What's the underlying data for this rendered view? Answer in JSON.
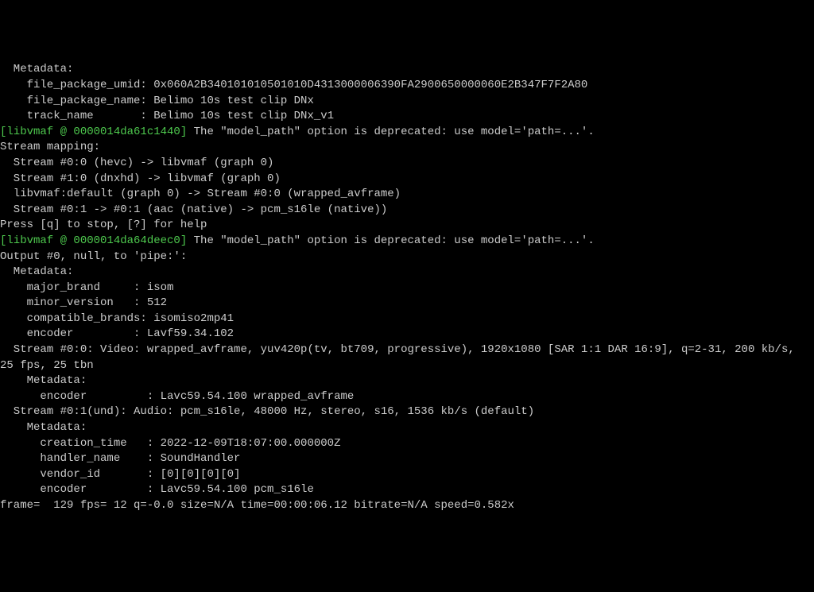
{
  "lines": {
    "l1": "  Metadata:",
    "l2": "    file_package_umid: 0x060A2B340101010501010D4313000006390FA2900650000060E2B347F7F2A80",
    "l3": "    file_package_name: Belimo 10s test clip DNx",
    "l4": "    track_name       : Belimo 10s test clip DNx_v1",
    "l5_tag": "[libvmaf @ 0000014da61c1440]",
    "l5_msg": " The \"model_path\" option is deprecated: use model='path=...'.",
    "l6": "Stream mapping:",
    "l7": "  Stream #0:0 (hevc) -> libvmaf (graph 0)",
    "l8": "  Stream #1:0 (dnxhd) -> libvmaf (graph 0)",
    "l9": "  libvmaf:default (graph 0) -> Stream #0:0 (wrapped_avframe)",
    "l10": "  Stream #0:1 -> #0:1 (aac (native) -> pcm_s16le (native))",
    "l11": "Press [q] to stop, [?] for help",
    "l12_tag": "[libvmaf @ 0000014da64deec0]",
    "l12_msg": " The \"model_path\" option is deprecated: use model='path=...'.",
    "l13": "Output #0, null, to 'pipe:':",
    "l14": "  Metadata:",
    "l15": "    major_brand     : isom",
    "l16": "    minor_version   : 512",
    "l17": "    compatible_brands: isomiso2mp41",
    "l18": "    encoder         : Lavf59.34.102",
    "l19": "  Stream #0:0: Video: wrapped_avframe, yuv420p(tv, bt709, progressive), 1920x1080 [SAR 1:1 DAR 16:9], q=2-31, 200 kb/s,",
    "l20": "25 fps, 25 tbn",
    "l21": "    Metadata:",
    "l22": "      encoder         : Lavc59.54.100 wrapped_avframe",
    "l23": "  Stream #0:1(und): Audio: pcm_s16le, 48000 Hz, stereo, s16, 1536 kb/s (default)",
    "l24": "    Metadata:",
    "l25": "      creation_time   : 2022-12-09T18:07:00.000000Z",
    "l26": "      handler_name    : SoundHandler",
    "l27": "      vendor_id       : [0][0][0][0]",
    "l28": "      encoder         : Lavc59.54.100 pcm_s16le",
    "l29": "frame=  129 fps= 12 q=-0.0 size=N/A time=00:00:06.12 bitrate=N/A speed=0.582x"
  }
}
